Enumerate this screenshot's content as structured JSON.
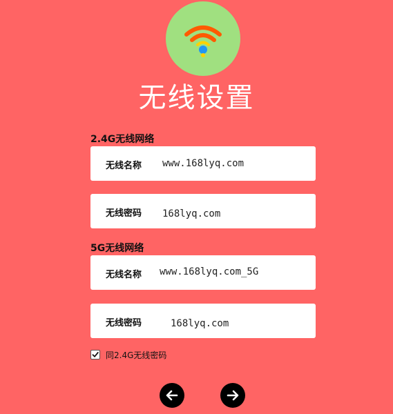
{
  "header": {
    "title": "无线设置",
    "logo_icon": "wifi-icon"
  },
  "sections": [
    {
      "heading": "2.4G无线网络",
      "ssid_label": "无线名称",
      "ssid_value": "www.168lyq.com",
      "password_label": "无线密码",
      "password_value": "168lyq.com"
    },
    {
      "heading": "5G无线网络",
      "ssid_label": "无线名称",
      "ssid_value": "www.168lyq.com_5G",
      "password_label": "无线密码",
      "password_value": "168lyq.com"
    }
  ],
  "same_password": {
    "label": "同2.4G无线密码",
    "checked": true
  },
  "navigation": {
    "back_icon": "arrow-left-icon",
    "next_icon": "arrow-right-icon"
  },
  "colors": {
    "background": "#ff6464",
    "logo_circle": "#a0e080",
    "wifi_arc": "#ff5a00",
    "wifi_dot": "#2196f3"
  }
}
